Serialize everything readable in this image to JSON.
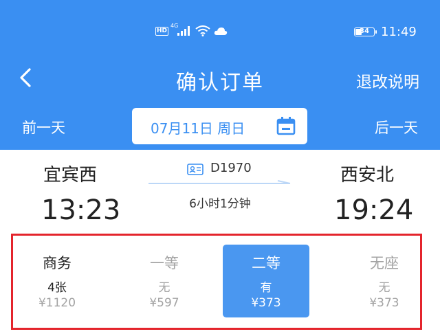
{
  "status_bar": {
    "hd": "HD",
    "network": "4G",
    "battery": "34",
    "time": "11:49"
  },
  "header": {
    "title": "确认订单",
    "right_action": "退改说明"
  },
  "date_bar": {
    "prev": "前一天",
    "date": "07月11日 周日",
    "next": "后一天"
  },
  "train": {
    "number": "D1970",
    "from_station": "宜宾西",
    "to_station": "西安北",
    "depart_time": "13:23",
    "arrive_time": "19:24",
    "duration": "6小时1分钟"
  },
  "seats": [
    {
      "name": "商务",
      "availability": "4张",
      "price": "¥1120"
    },
    {
      "name": "一等",
      "availability": "无",
      "price": "¥597"
    },
    {
      "name": "二等",
      "availability": "有",
      "price": "¥373",
      "selected": true
    },
    {
      "name": "无座",
      "availability": "无",
      "price": "¥373"
    }
  ],
  "colors": {
    "primary": "#3a8ff2",
    "selected_seat": "#4a97f0",
    "highlight_border": "#e4242c",
    "muted": "#a3a3a3"
  },
  "icons": [
    "hd-icon",
    "signal-icon",
    "wifi-icon",
    "cloud-icon",
    "battery-icon",
    "back-arrow-icon",
    "calendar-icon",
    "train-id-icon"
  ]
}
